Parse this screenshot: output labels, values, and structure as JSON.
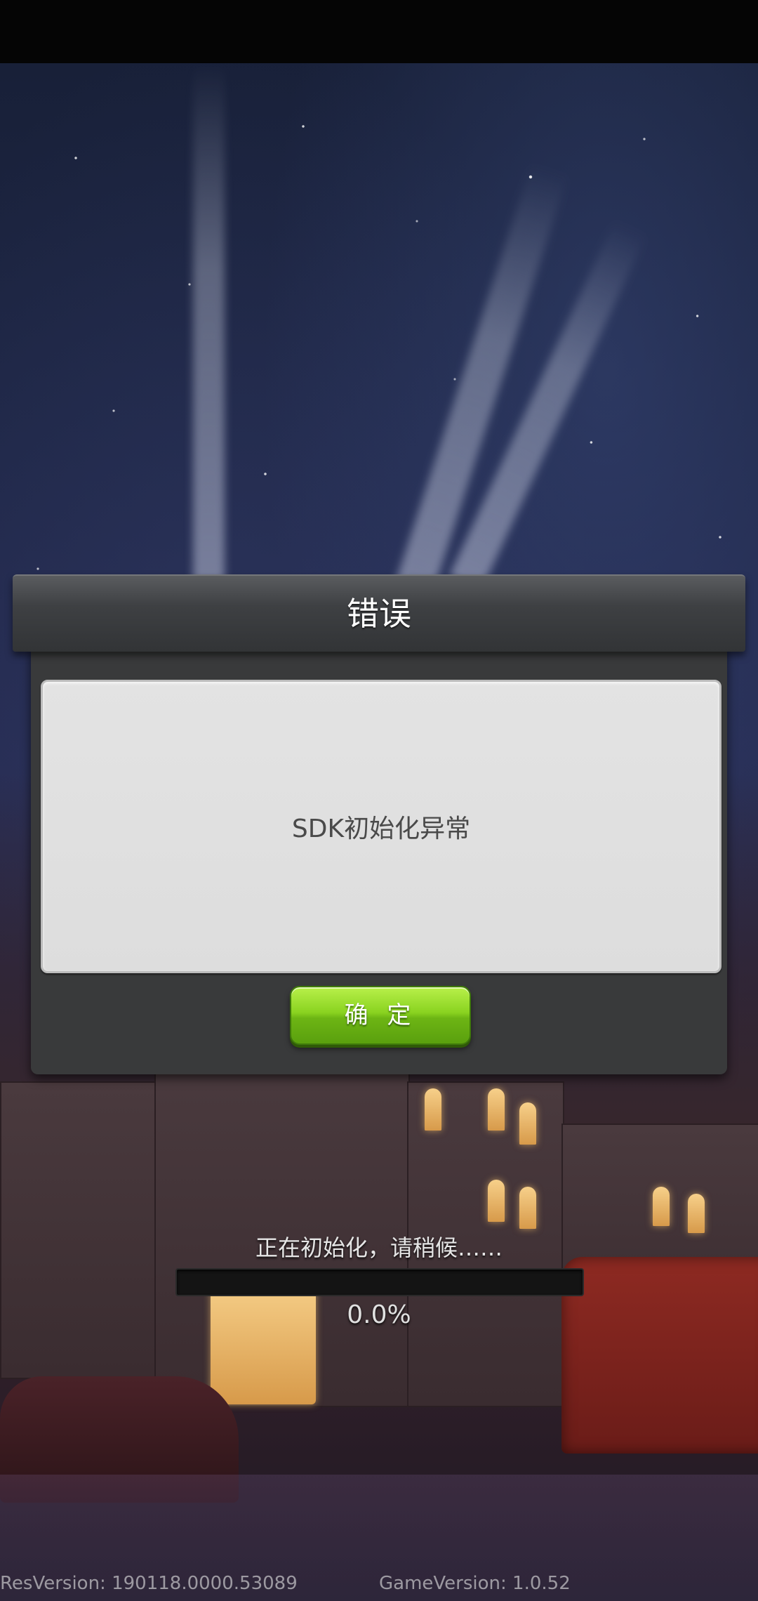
{
  "dialog": {
    "title": "错误",
    "message": "SDK初始化异常",
    "confirm_label": "确 定"
  },
  "loading": {
    "status_text": "正在初始化，请稍候……",
    "progress_percent_text": "0.0%",
    "progress_fraction": 0.0
  },
  "footer": {
    "res_version": "ResVersion:  190118.0000.53089",
    "game_version": "GameVersion: 1.0.52"
  },
  "colors": {
    "accent_green": "#8ad320",
    "dialog_dark": "#393a3b",
    "message_bg": "#e0e0e0"
  }
}
